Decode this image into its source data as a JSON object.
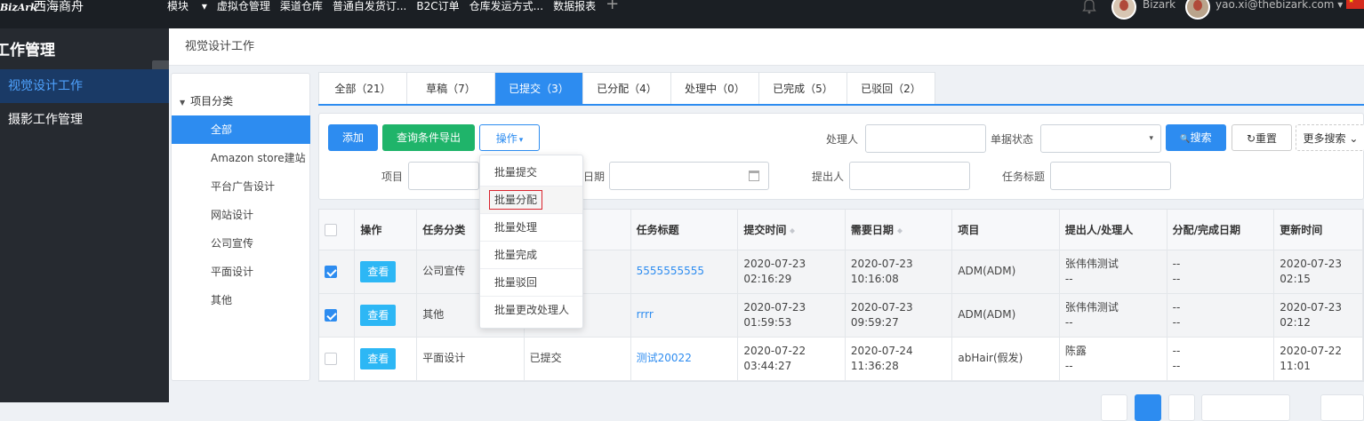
{
  "topbar": {
    "logo_mark": "BizArk",
    "brand": "西海商舟",
    "nav": [
      "模块",
      "虚拟仓管理",
      "渠道仓库",
      "普通自发货订...",
      "B2C订单",
      "仓库发运方式...",
      "数据报表"
    ],
    "nav_module_caret": "▾",
    "plus": "+",
    "user1": "Bizark",
    "user2": "yao.xi@thebizark.com",
    "user2_caret": "▾"
  },
  "sidebar": {
    "title": "工作管理",
    "collapse": "‹",
    "items": [
      {
        "label": "视觉设计工作",
        "active": true
      },
      {
        "label": "摄影工作管理",
        "active": false
      }
    ]
  },
  "breadcrumb": "视觉设计工作",
  "tree": {
    "root": "项目分类",
    "root_caret": "▼",
    "items": [
      "全部",
      "Amazon store建站",
      "平台广告设计",
      "网站设计",
      "公司宣传",
      "平面设计",
      "其他"
    ]
  },
  "tabs": [
    "全部（21）",
    "草稿（7）",
    "已提交（3）",
    "已分配（4）",
    "处理中（0）",
    "已完成（5）",
    "已驳回（2）"
  ],
  "toolbar": {
    "add": "添加",
    "export": "查询条件导出",
    "ops": "操作",
    "ops_caret": "▾",
    "search": "搜索",
    "search_icon": "🔍",
    "reset": "重置",
    "reset_icon": "↻",
    "more": "更多搜索",
    "more_caret": "⌄"
  },
  "filters": {
    "handler": "处理人",
    "doc_status": "单据状态",
    "doc_status_caret": "▾",
    "project": "项目",
    "date": "日期",
    "proposer": "提出人",
    "task_title": "任务标题"
  },
  "dropdown": [
    "批量提交",
    "批量分配",
    "批量处理",
    "批量完成",
    "批量驳回",
    "批量更改处理人"
  ],
  "table": {
    "headers": [
      "操作",
      "任务分类",
      "",
      "任务标题",
      "提交时间",
      "需要日期",
      "项目",
      "提出人/处理人",
      "分配/完成日期",
      "更新时间"
    ],
    "view_label": "查看",
    "rows": [
      {
        "checked": true,
        "category": "公司宣传",
        "status": "",
        "title": "5555555555",
        "submit": "2020-07-23 02:16:29",
        "need": "2020-07-23 10:16:08",
        "project": "ADM(ADM)",
        "person1": "张伟伟测试",
        "person2": "--",
        "assign1": "--",
        "assign2": "--",
        "update": "2020-07-23 02:15"
      },
      {
        "checked": true,
        "category": "其他",
        "status": "",
        "title": "rrrr",
        "submit": "2020-07-23 01:59:53",
        "need": "2020-07-23 09:59:27",
        "project": "ADM(ADM)",
        "person1": "张伟伟测试",
        "person2": "--",
        "assign1": "--",
        "assign2": "--",
        "update": "2020-07-23 02:12"
      },
      {
        "checked": false,
        "category": "平面设计",
        "status": "已提交",
        "title": "测试20022",
        "submit": "2020-07-22 03:44:27",
        "need": "2020-07-24 11:36:28",
        "project": "abHair(假发)",
        "person1": "陈露",
        "person2": "--",
        "assign1": "--",
        "assign2": "--",
        "update": "2020-07-22 11:01"
      }
    ]
  },
  "colors": {
    "primary": "#2d8cf0",
    "green": "#1fb46a",
    "view": "#2db7f5",
    "dark": "#1b1f24",
    "sidebar": "#262a30"
  }
}
